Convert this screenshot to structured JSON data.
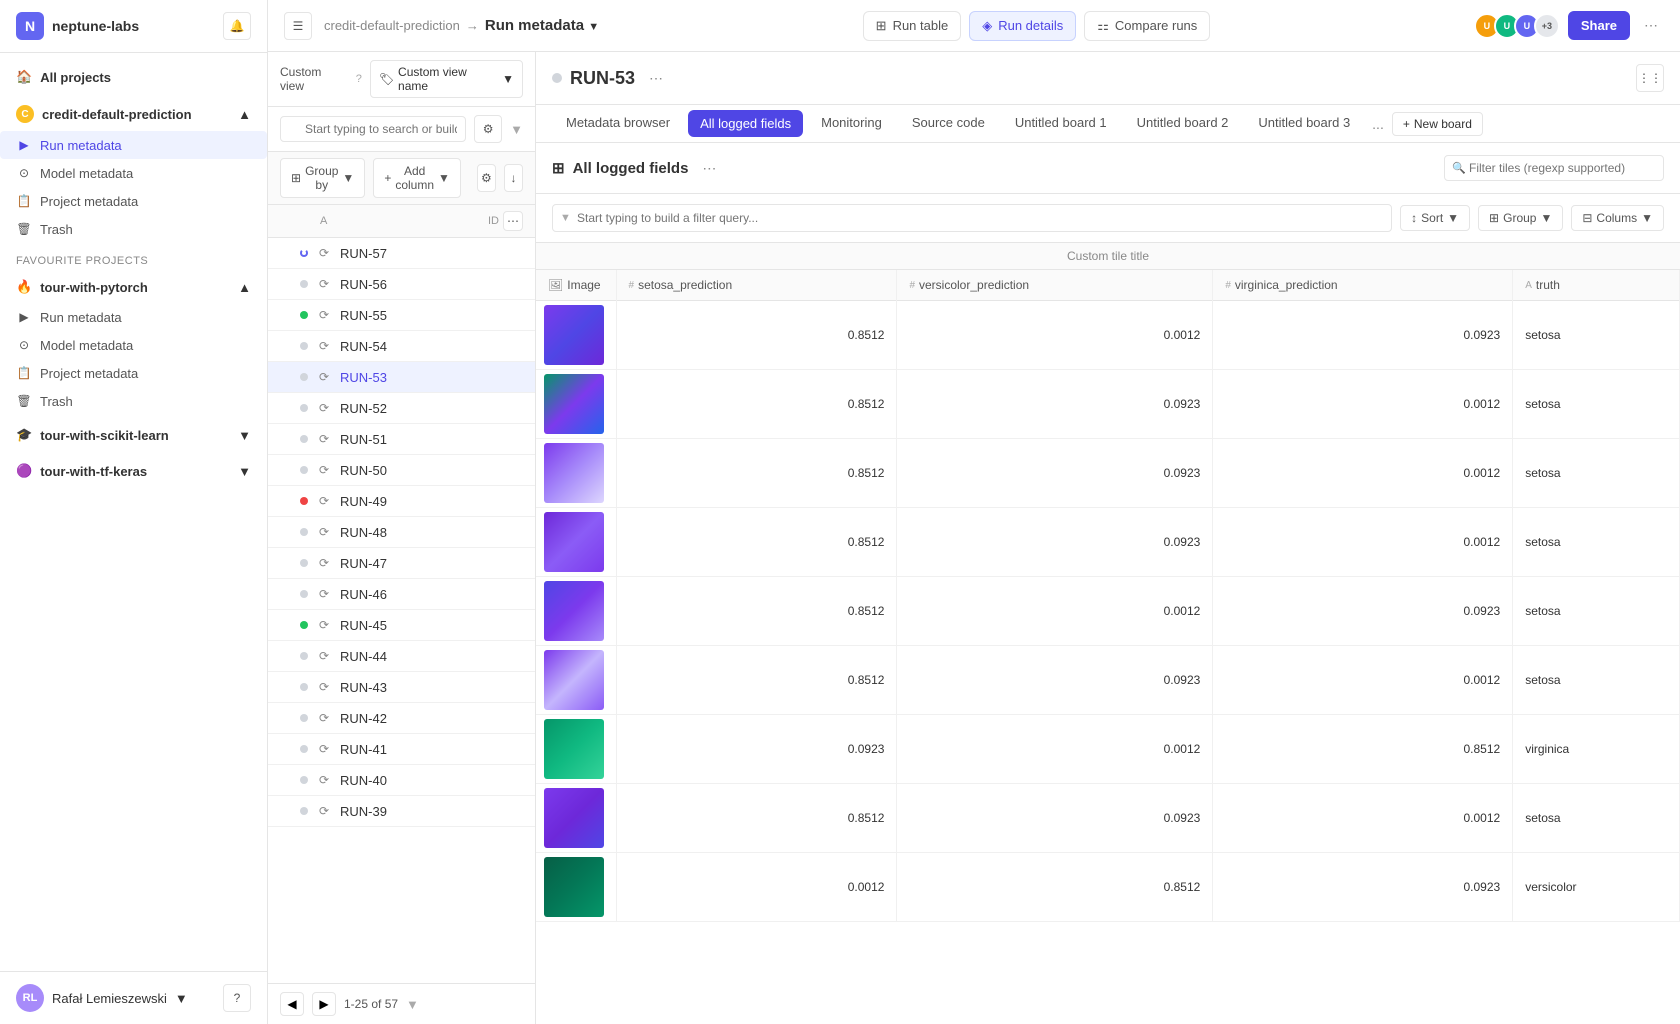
{
  "app": {
    "name": "neptune-labs",
    "logo_letter": "N"
  },
  "topbar": {
    "breadcrumb": "credit-default-prediction",
    "title": "Run metadata",
    "run_table_label": "Run table",
    "run_details_label": "Run details",
    "compare_runs_label": "Compare runs",
    "share_label": "Share",
    "avatar_count": "+3"
  },
  "sidebar": {
    "all_projects_label": "All projects",
    "main_project": {
      "name": "credit-default-prediction",
      "items": [
        {
          "label": "Run metadata",
          "active": true
        },
        {
          "label": "Model metadata"
        },
        {
          "label": "Project metadata"
        },
        {
          "label": "Trash"
        }
      ]
    },
    "favourite_label": "Favourite projects",
    "projects": [
      {
        "name": "tour-with-pytorch",
        "icon": "🔥",
        "items": [
          {
            "label": "Run metadata"
          },
          {
            "label": "Model metadata"
          },
          {
            "label": "Project metadata"
          },
          {
            "label": "Trash"
          }
        ]
      },
      {
        "name": "tour-with-scikit-learn",
        "icon": "🎓"
      },
      {
        "name": "tour-with-tf-keras",
        "icon": "🟣"
      }
    ],
    "user_name": "Rafał Lemieszewski",
    "help_icon": "?"
  },
  "run_list": {
    "custom_view_label": "Custom view",
    "custom_view_name_label": "Custom view name",
    "search_placeholder": "Start typing to search or build a filter query...",
    "col_a_label": "A",
    "col_id_label": "ID",
    "pagination": "1-25 of 57",
    "runs": [
      {
        "id": "RUN-57",
        "status": "loading"
      },
      {
        "id": "RUN-56",
        "status": "default"
      },
      {
        "id": "RUN-55",
        "status": "active-run"
      },
      {
        "id": "RUN-54",
        "status": "default"
      },
      {
        "id": "RUN-53",
        "status": "default",
        "active": true
      },
      {
        "id": "RUN-52",
        "status": "default"
      },
      {
        "id": "RUN-51",
        "status": "default"
      },
      {
        "id": "RUN-50",
        "status": "default"
      },
      {
        "id": "RUN-49",
        "status": "error"
      },
      {
        "id": "RUN-48",
        "status": "default"
      },
      {
        "id": "RUN-47",
        "status": "default"
      },
      {
        "id": "RUN-46",
        "status": "default"
      },
      {
        "id": "RUN-45",
        "status": "active-run"
      },
      {
        "id": "RUN-44",
        "status": "default"
      },
      {
        "id": "RUN-43",
        "status": "default"
      },
      {
        "id": "RUN-42",
        "status": "default"
      },
      {
        "id": "RUN-41",
        "status": "default"
      },
      {
        "id": "RUN-40",
        "status": "default"
      },
      {
        "id": "RUN-39",
        "status": "default"
      }
    ]
  },
  "detail": {
    "run_id": "RUN-53",
    "run_status": "inactive",
    "tabs": [
      {
        "label": "Metadata browser"
      },
      {
        "label": "All logged fields",
        "active": true,
        "highlighted": true
      },
      {
        "label": "Monitoring"
      },
      {
        "label": "Source code"
      },
      {
        "label": "Untitled board 1"
      },
      {
        "label": "Untitled board 2"
      },
      {
        "label": "Untitled board 3"
      }
    ],
    "new_board_label": "New board",
    "more_tabs_label": "...",
    "fields_section": {
      "title": "All logged fields",
      "filter_placeholder": "Start typing to build a filter query...",
      "custom_tile_title": "Custom tile title",
      "filter_input_placeholder": "Filter tiles (regexp supported)",
      "group_by_label": "Group by",
      "add_column_label": "Add column",
      "sort_label": "Sort",
      "group_label": "Group",
      "columns_label": "Colums",
      "table": {
        "columns": [
          {
            "name": "Image",
            "type": "image",
            "icon": "🖼"
          },
          {
            "name": "setosa_prediction",
            "type": "number",
            "icon": "#"
          },
          {
            "name": "versicolor_prediction",
            "type": "number",
            "icon": "#"
          },
          {
            "name": "virginica_prediction",
            "type": "number",
            "icon": "#"
          },
          {
            "name": "truth",
            "type": "string",
            "icon": "A"
          }
        ],
        "rows": [
          {
            "image_class": "iris-1",
            "setosa": "0.8512",
            "versicolor": "0.0012",
            "virginica": "0.0923",
            "truth": "setosa"
          },
          {
            "image_class": "iris-2",
            "setosa": "0.8512",
            "versicolor": "0.0923",
            "virginica": "0.0012",
            "truth": "setosa"
          },
          {
            "image_class": "iris-3",
            "setosa": "0.8512",
            "versicolor": "0.0923",
            "virginica": "0.0012",
            "truth": "setosa"
          },
          {
            "image_class": "iris-4",
            "setosa": "0.8512",
            "versicolor": "0.0923",
            "virginica": "0.0012",
            "truth": "setosa"
          },
          {
            "image_class": "iris-5",
            "setosa": "0.8512",
            "versicolor": "0.0012",
            "virginica": "0.0923",
            "truth": "setosa"
          },
          {
            "image_class": "iris-6",
            "setosa": "0.8512",
            "versicolor": "0.0923",
            "virginica": "0.0012",
            "truth": "setosa"
          },
          {
            "image_class": "iris-7",
            "setosa": "0.0923",
            "versicolor": "0.0012",
            "virginica": "0.8512",
            "truth": "virginica"
          },
          {
            "image_class": "iris-8",
            "setosa": "0.8512",
            "versicolor": "0.0923",
            "virginica": "0.0012",
            "truth": "setosa"
          },
          {
            "image_class": "iris-9",
            "setosa": "0.0012",
            "versicolor": "0.8512",
            "virginica": "0.0923",
            "truth": "versicolor"
          }
        ]
      }
    }
  }
}
